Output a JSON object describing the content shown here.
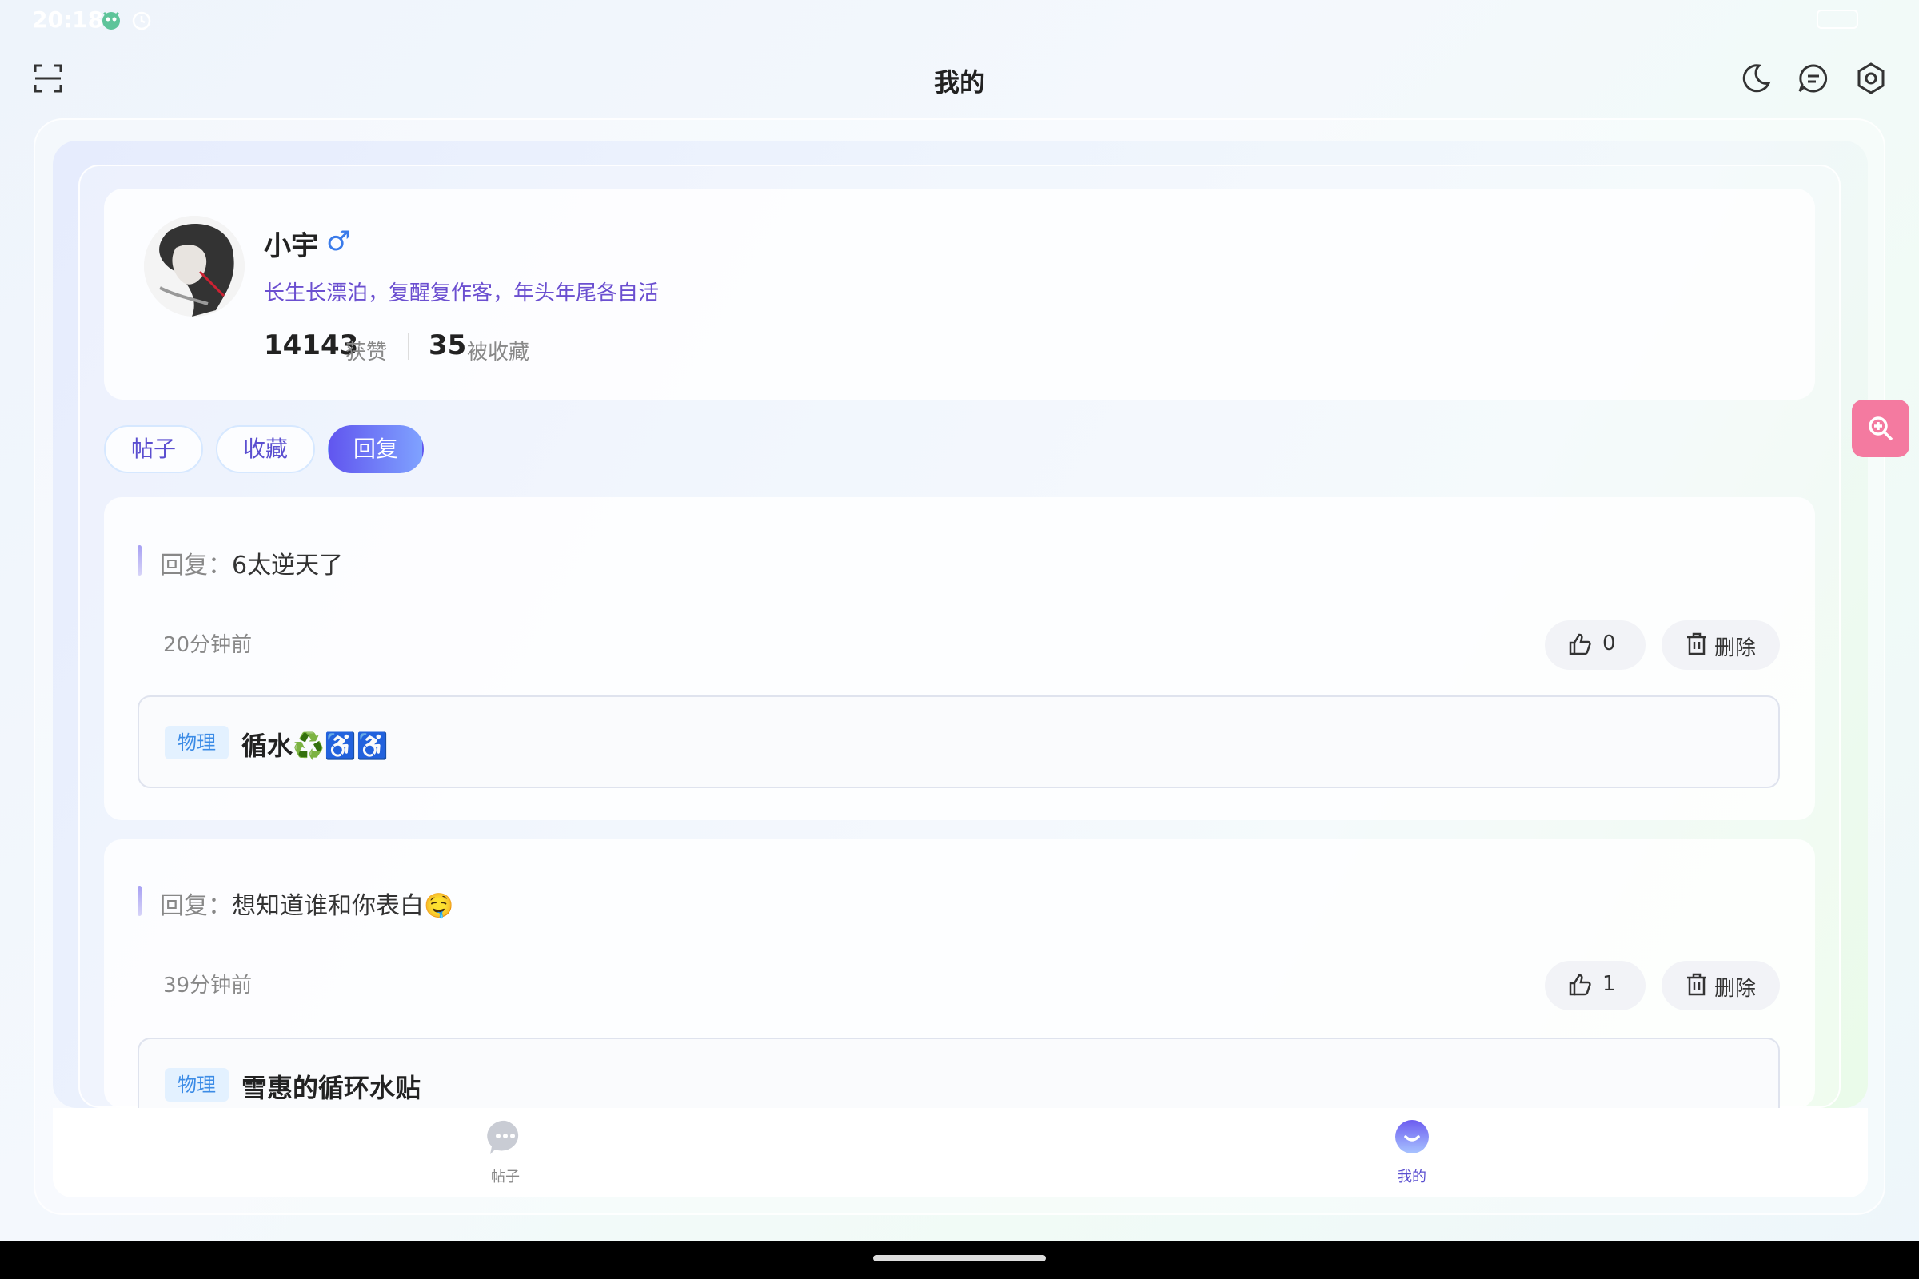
{
  "status_bar": {
    "time": "20:18"
  },
  "header": {
    "title": "我的"
  },
  "profile": {
    "name": "小宇",
    "gender_symbol": "♂",
    "bio": "长生长漂泊，复醒复作客，年头年尾各自活",
    "likes_count": "14143",
    "likes_label": "获赞",
    "favorited_count": "35",
    "favorited_label": "被收藏"
  },
  "tabs": [
    {
      "label": "帖子",
      "active": false
    },
    {
      "label": "收藏",
      "active": false
    },
    {
      "label": "回复",
      "active": true
    }
  ],
  "replies": [
    {
      "prefix": "回复：",
      "text": "6太逆天了",
      "time": "20分钟前",
      "likes": "0",
      "delete_label": "删除",
      "post": {
        "tag": "物理",
        "title": "循水♻️♿️♿️"
      }
    },
    {
      "prefix": "回复：",
      "text": "想知道谁和你表白🤤",
      "time": "39分钟前",
      "likes": "1",
      "delete_label": "删除",
      "post": {
        "tag": "物理",
        "title": "雪惠的循环水贴"
      }
    }
  ],
  "bottom_nav": [
    {
      "label": "帖子",
      "active": false
    },
    {
      "label": "我的",
      "active": true
    }
  ],
  "icons": {
    "scan": "scan-icon",
    "theme": "moon-icon",
    "messages": "message-icon",
    "settings": "settings-icon",
    "like": "thumb-up-icon",
    "delete": "trash-icon",
    "zoom": "zoom-in-icon"
  },
  "colors": {
    "accent": "#6156ef",
    "bio": "#6b4fd0",
    "tag_bg": "#e3f1ff",
    "tag_text": "#3b8be6",
    "float_button": "#f47aa0"
  }
}
